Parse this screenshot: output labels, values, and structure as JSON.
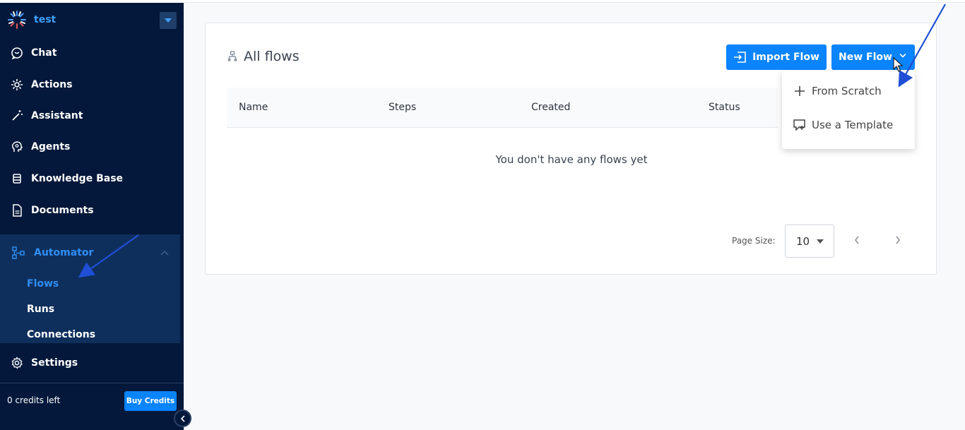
{
  "workspace": {
    "name": "test"
  },
  "sidebar": {
    "items": [
      {
        "label": "Chat",
        "icon": "chat-icon"
      },
      {
        "label": "Actions",
        "icon": "actions-icon"
      },
      {
        "label": "Assistant",
        "icon": "magic-wand-icon"
      },
      {
        "label": "Agents",
        "icon": "agent-head-icon"
      },
      {
        "label": "Knowledge Base",
        "icon": "database-icon"
      },
      {
        "label": "Documents",
        "icon": "document-icon"
      }
    ],
    "automator": {
      "label": "Automator",
      "icon": "flow-diagram-icon",
      "subitems": [
        {
          "label": "Flows",
          "active": true
        },
        {
          "label": "Runs",
          "active": false
        },
        {
          "label": "Connections",
          "active": false
        }
      ]
    },
    "settings": {
      "label": "Settings",
      "icon": "gear-icon"
    },
    "credits_text": "0 credits left",
    "buy_credits_label": "Buy Credits"
  },
  "main": {
    "title": "All flows",
    "import_label": "Import Flow",
    "new_flow_label": "New Flow",
    "columns": [
      "Name",
      "Steps",
      "Created",
      "Status"
    ],
    "empty_message": "You don't have any flows yet",
    "page_size_label": "Page Size:",
    "page_size_value": "10"
  },
  "dropdown": {
    "items": [
      {
        "label": "From Scratch",
        "icon": "plus-icon"
      },
      {
        "label": "Use a Template",
        "icon": "template-icon"
      }
    ]
  },
  "colors": {
    "sidebar_bg": "#03183a",
    "accent": "#0a84ff",
    "active_text": "#2f8ef5",
    "annotation_arrow": "#1f4fd6"
  }
}
